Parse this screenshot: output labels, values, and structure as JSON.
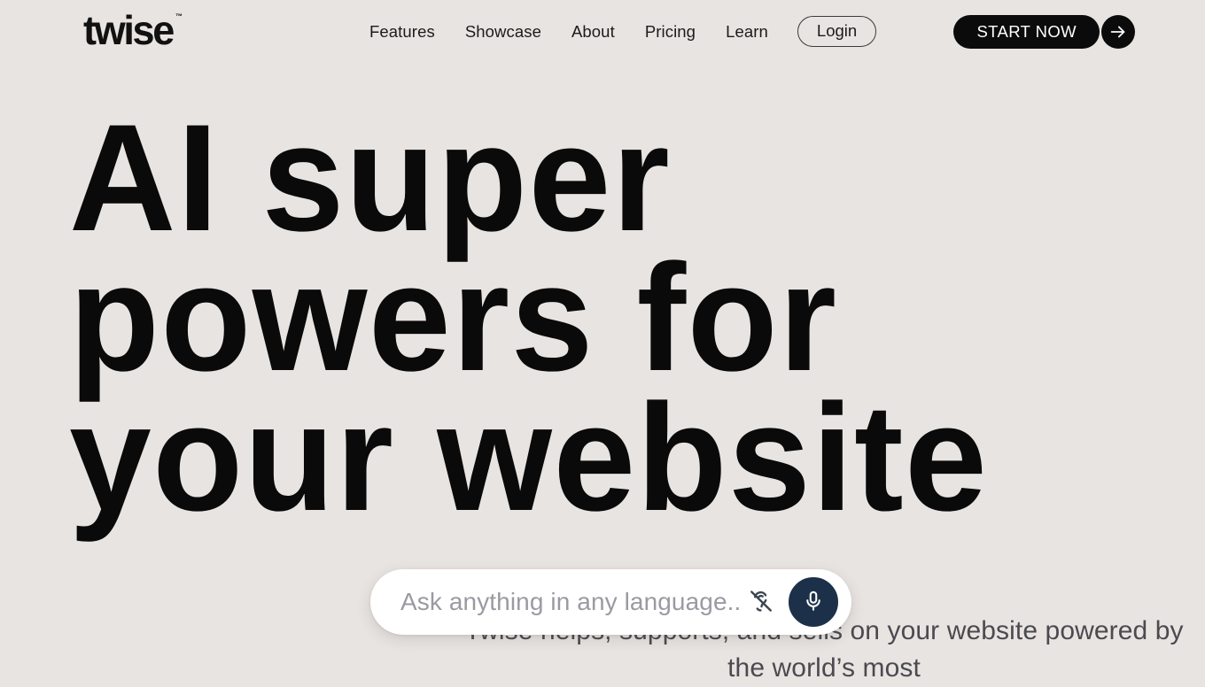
{
  "page": {
    "background_color": "#E8E4E1",
    "accent_dark": "#0b0b0b",
    "mic_button_color": "#1c3149"
  },
  "header": {
    "logo": {
      "text": "twise",
      "trademark": "™"
    },
    "nav_items": [
      {
        "label": "Features"
      },
      {
        "label": "Showcase"
      },
      {
        "label": "About"
      },
      {
        "label": "Pricing"
      },
      {
        "label": "Learn"
      }
    ],
    "login_label": "Login",
    "cta": {
      "label": "START NOW",
      "arrow_icon": "arrow-right-icon"
    }
  },
  "hero": {
    "headline_lines": [
      "AI super",
      "powers for",
      "your website"
    ],
    "body_text": "Twise helps, supports, and sells on your website powered by the world’s most"
  },
  "ask_widget": {
    "placeholder": "Ask anything in any language...",
    "value": "",
    "hearing_icon": "ear-muted-icon",
    "mic_icon": "microphone-icon"
  }
}
